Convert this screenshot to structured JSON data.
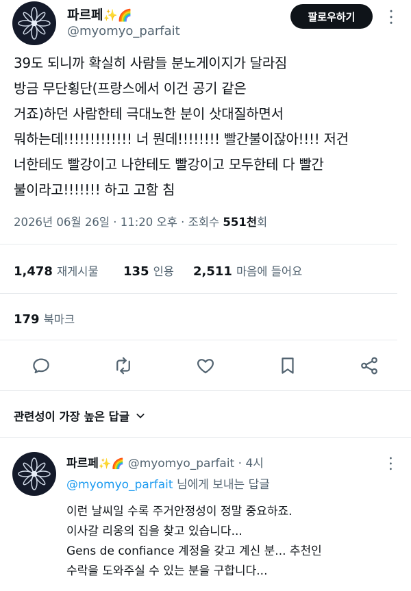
{
  "author": {
    "name": "파르페",
    "name_emoji": "✨🌈",
    "handle": "@myomyo_parfait"
  },
  "follow_label": "팔로우하기",
  "more_icon": "•••",
  "tweet": {
    "text": "39도 되니까 확실히 사람들 분노게이지가 달라짐\n방금 무단횡단(프랑스에서 이건 공기 같은\n거죠)하던 사람한테 극대노한 분이 삿대질하면서\n뭐하는데!!!!!!!!!!!!! 너 뭔데!!!!!!!! 빨간불이잖아!!!! 저건\n너한테도 빨강이고 나한테도 빨강이고 모두한테 다 빨간\n불이라고!!!!!!! 하고 고함 침",
    "date": "2026년 06월 26일 · 11:20 오후 · 조회수 ",
    "views": "551천",
    "views_suffix": "회"
  },
  "stats": {
    "retweets": "1,478",
    "retweets_label": "재게시물",
    "quotes": "135",
    "quotes_label": "인용",
    "likes": "2,511",
    "likes_label": "마음에 들어요",
    "bookmarks": "179",
    "bookmarks_label": "북마크"
  },
  "actions": [
    "reply-icon",
    "retweet-icon",
    "heart-icon",
    "bookmark-icon",
    "share-icon"
  ],
  "sort_label": "관련성이 가장 높은 답글",
  "reply": {
    "name": "파르페",
    "name_emoji": "✨🌈",
    "handle": "@myomyo_parfait",
    "time": "· 4시",
    "reply_to_handle": "@myomyo_parfait",
    "reply_to_suffix": " 님에게 보내는 답글",
    "text": "이런 날씨일 수록 주거안정성이 정말 중요하죠.\n이사갈 리옹의 집을 찾고 있습니다...\nGens de confiance 계정을 갖고 계신 분... 추천인\n수락을 도와주실 수 있는 분을 구합니다..."
  },
  "colors": {
    "accent": "#1d9bf0",
    "text": "#0f1419",
    "muted": "#536471",
    "avatar_bg": "#141a2a"
  }
}
